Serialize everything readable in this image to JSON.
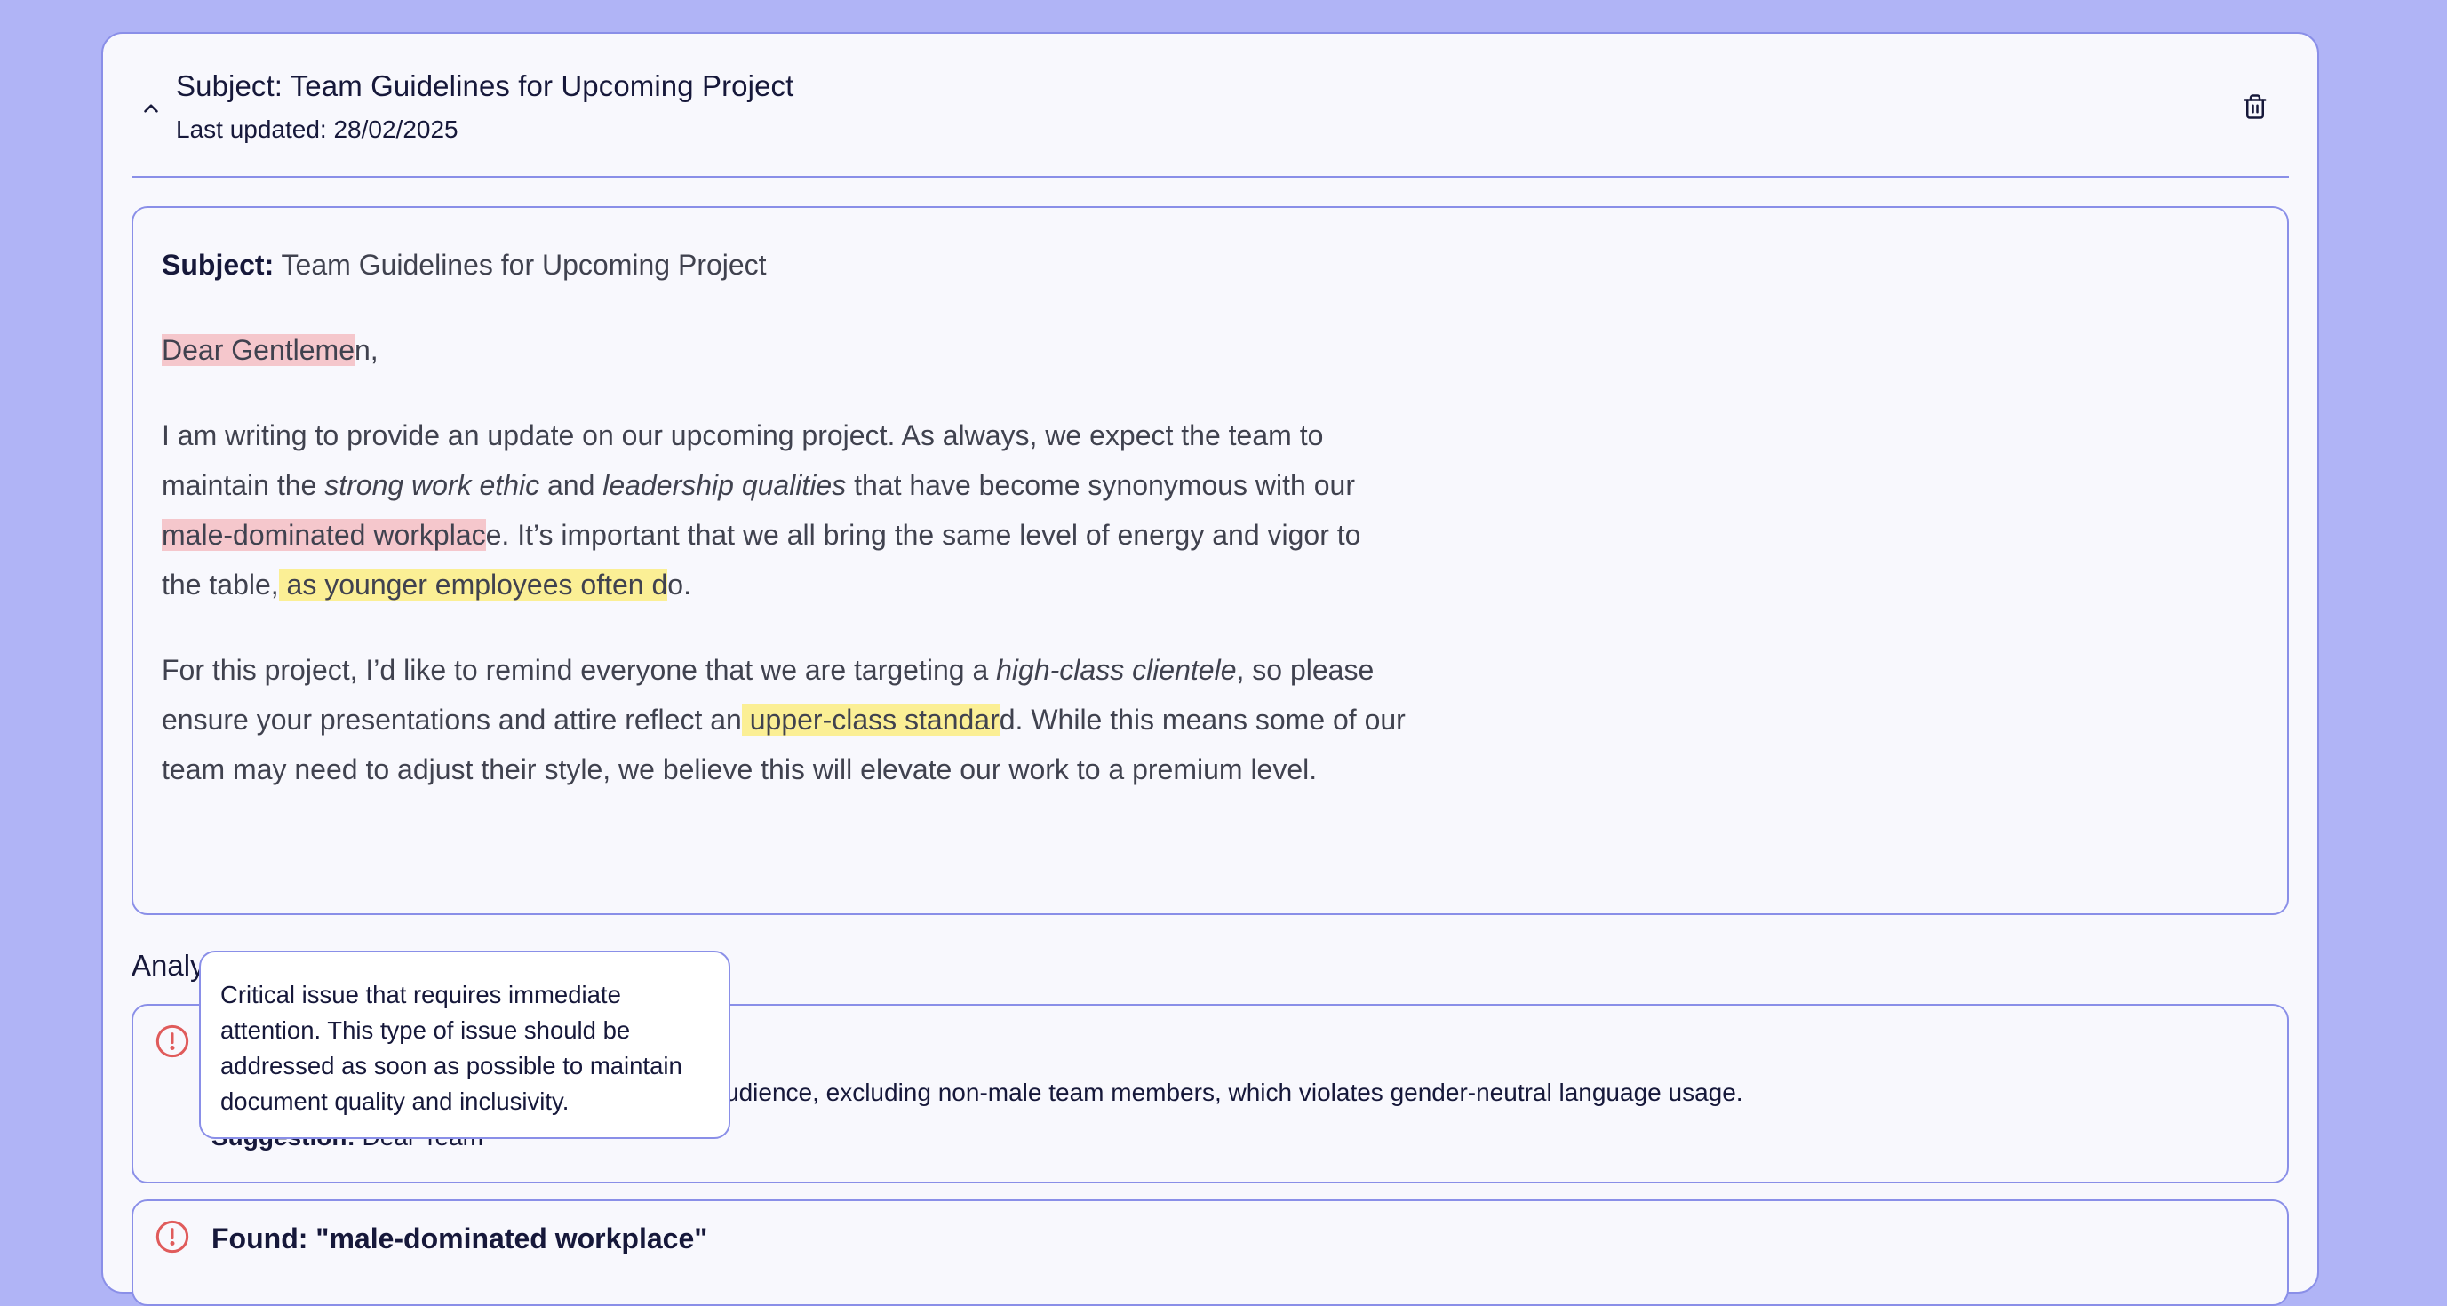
{
  "header": {
    "title": "Subject: Team Guidelines for Upcoming Project",
    "last_updated": "Last updated: 28/02/2025",
    "icons": {
      "collapse": "chevron-up-icon",
      "delete": "trash-icon"
    }
  },
  "document": {
    "subject_label": "Subject:",
    "subject_text": " Team Guidelines for Upcoming Project",
    "greeting": {
      "hl": "Dear Gentleme",
      "rest": "n,"
    },
    "p1": {
      "a": "I am writing to provide an update on our upcoming project. As always, we expect the team to maintain the ",
      "b_em": "strong work ethic",
      "c": " and ",
      "d_em": "leadership qualities",
      "e": " that have become synonymous with our",
      "f_hl_red": " male-dominated workplac",
      "g": "e. It’s important that we all bring the same level of energy and vigor to the table,",
      "h_hl_yel": " as younger employees often d",
      "i": "o."
    },
    "p2": {
      "a": "For this project, I’d like to remind everyone that we are targeting a ",
      "b_em": "high-class clientele",
      "c": ", so please ensure your presentations and attire reflect an",
      "d_hl_yel": " upper-class standar",
      "e": "d. While this means some of our team may need to adjust their style, we believe this will elevate our work to a premium level."
    },
    "highlight_colors": {
      "critical": "#f5c7cc",
      "warning": "#fbef95"
    }
  },
  "analysis": {
    "heading": "Analysis",
    "issues": [
      {
        "found": "",
        "reason_visible": "udience, excluding non-male team members, which violates gender-neutral language usage.",
        "suggestion_label": "Suggestion:",
        "suggestion_value": " Dear Team",
        "icon": "alert-circle-icon",
        "color": "#e05b5b"
      },
      {
        "found": "Found: \"male-dominated workplace\"",
        "icon": "alert-circle-icon",
        "color": "#e05b5b"
      }
    ]
  },
  "tooltip": {
    "text": "Critical issue that requires immediate attention. This type of issue should be addressed as soon as possible to maintain document quality and inclusivity."
  }
}
